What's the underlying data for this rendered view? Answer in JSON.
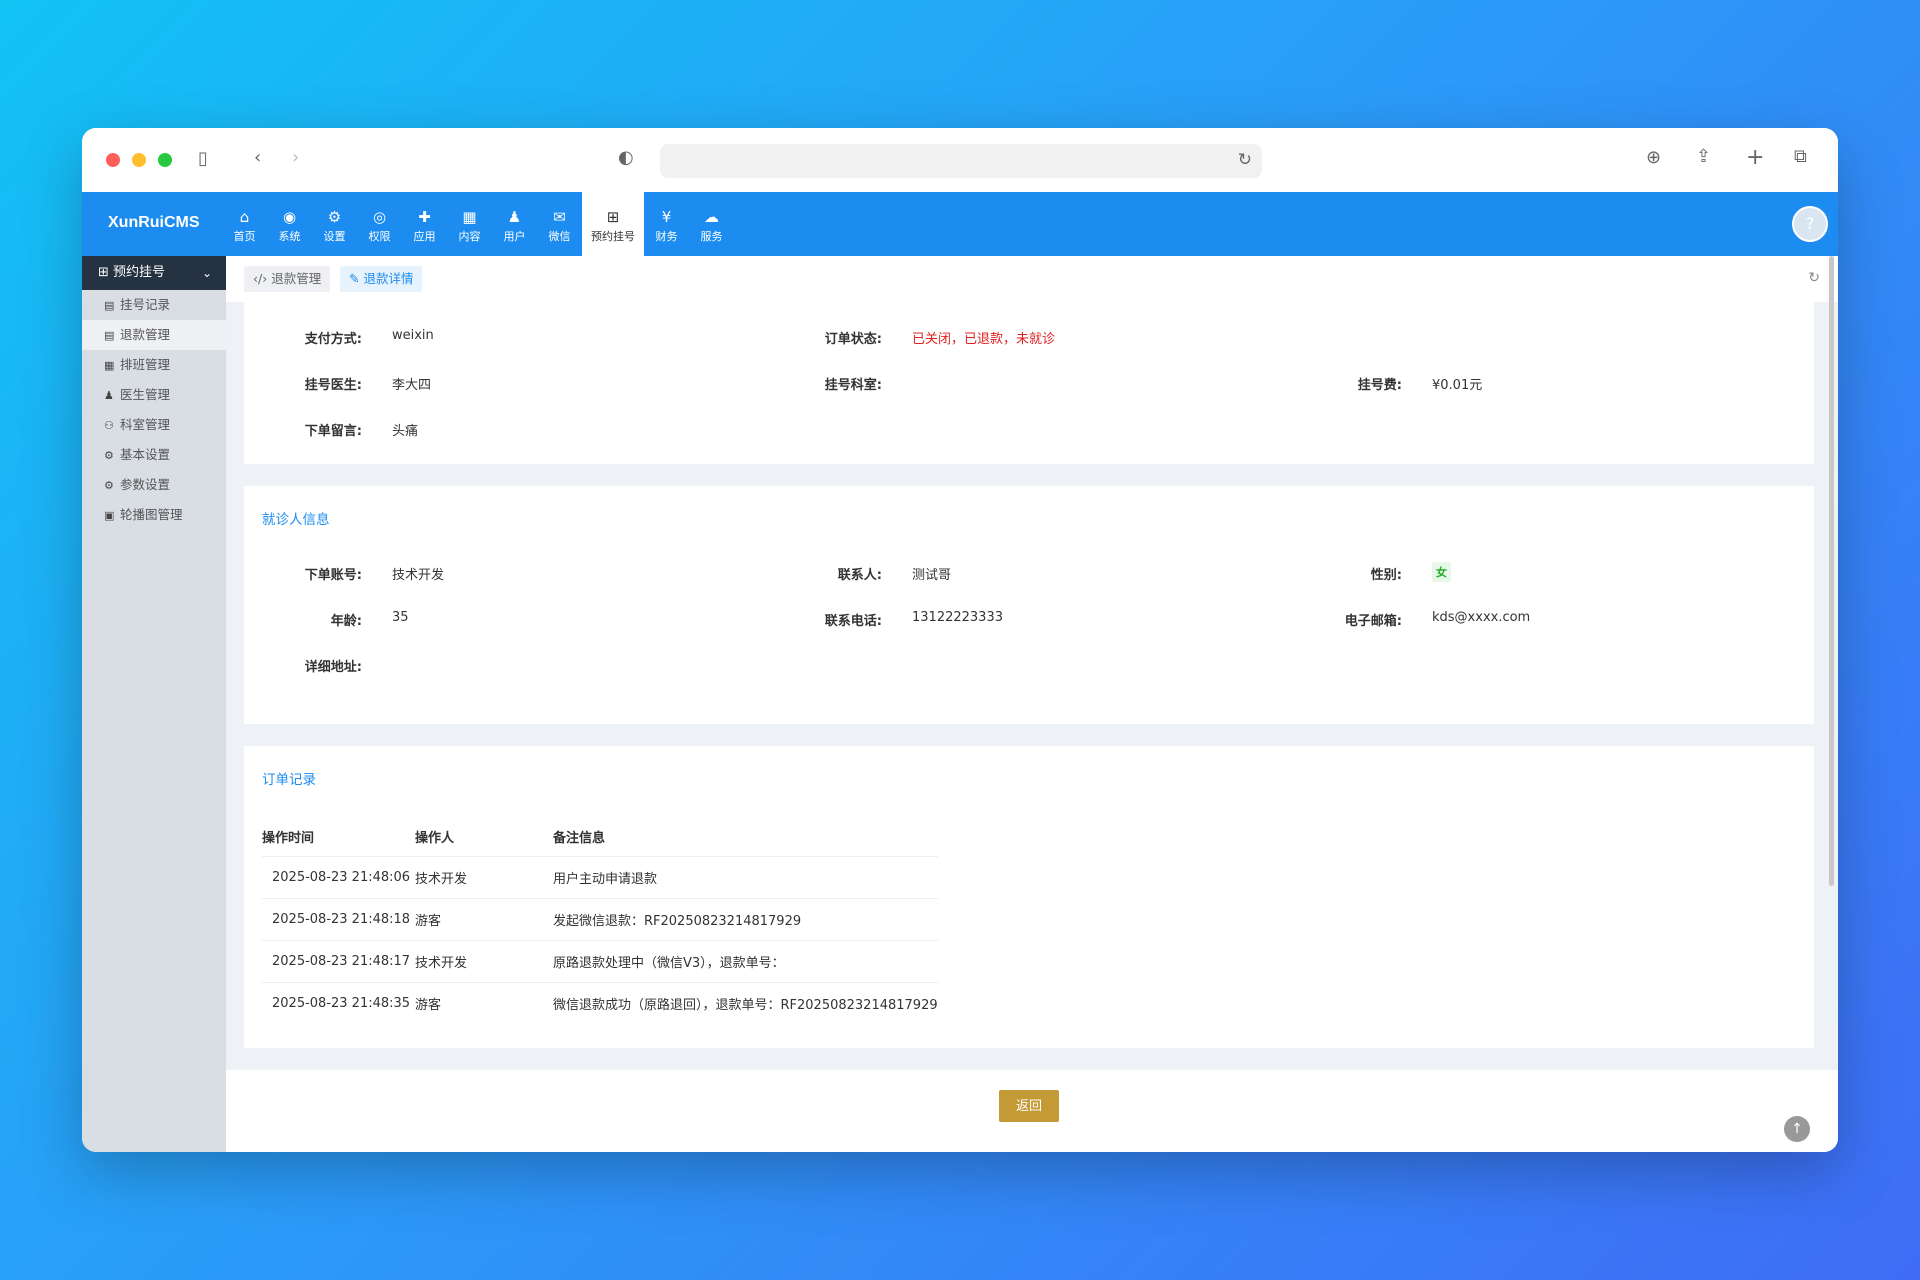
{
  "app": {
    "logo": "XunRuiCMS"
  },
  "nav": [
    {
      "icon": "⌂",
      "label": "首页"
    },
    {
      "icon": "◉",
      "label": "系统"
    },
    {
      "icon": "⚙",
      "label": "设置"
    },
    {
      "icon": "◎",
      "label": "权限"
    },
    {
      "icon": "✚",
      "label": "应用"
    },
    {
      "icon": "▦",
      "label": "内容"
    },
    {
      "icon": "♟",
      "label": "用户"
    },
    {
      "icon": "✉",
      "label": "微信"
    },
    {
      "icon": "⊞",
      "label": "预约挂号"
    },
    {
      "icon": "¥",
      "label": "财务"
    },
    {
      "icon": "☁",
      "label": "服务"
    }
  ],
  "sidebar": {
    "head": "预约挂号",
    "items": [
      {
        "icon": "▤",
        "label": "挂号记录"
      },
      {
        "icon": "▤",
        "label": "退款管理"
      },
      {
        "icon": "▦",
        "label": "排班管理"
      },
      {
        "icon": "♟",
        "label": "医生管理"
      },
      {
        "icon": "⚇",
        "label": "科室管理"
      },
      {
        "icon": "⚙",
        "label": "基本设置"
      },
      {
        "icon": "⚙",
        "label": "参数设置"
      },
      {
        "icon": "▣",
        "label": "轮播图管理"
      }
    ]
  },
  "tabs": {
    "t1": "退款管理",
    "t2": "退款详情"
  },
  "order": {
    "pay_method_label": "支付方式:",
    "pay_method": "weixin",
    "status_label": "订单状态:",
    "status": "已关闭，已退款，未就诊",
    "doctor_label": "挂号医生:",
    "doctor": "李大四",
    "dept_label": "挂号科室:",
    "dept": "",
    "fee_label": "挂号费:",
    "fee": "¥0.01元",
    "note_label": "下单留言:",
    "note": "头痛"
  },
  "patient": {
    "title": "就诊人信息",
    "account_label": "下单账号:",
    "account": "技术开发",
    "contact_label": "联系人:",
    "contact": "测试哥",
    "gender_label": "性别:",
    "gender": "女",
    "age_label": "年龄:",
    "age": "35",
    "phone_label": "联系电话:",
    "phone": "13122223333",
    "email_label": "电子邮箱:",
    "email": "kds@xxxx.com",
    "address_label": "详细地址:",
    "address": ""
  },
  "records": {
    "title": "订单记录",
    "headers": [
      "操作时间",
      "操作人",
      "备注信息"
    ],
    "rows": [
      [
        "2025-08-23 21:48:06",
        "技术开发",
        "用户主动申请退款"
      ],
      [
        "2025-08-23 21:48:18",
        "游客",
        "发起微信退款：RF20250823214817929"
      ],
      [
        "2025-08-23 21:48:17",
        "技术开发",
        "原路退款处理中（微信V3），退款单号："
      ],
      [
        "2025-08-23 21:48:35",
        "游客",
        "微信退款成功（原路退回），退款单号：RF20250823214817929"
      ]
    ]
  },
  "footer": {
    "back": "返回"
  }
}
